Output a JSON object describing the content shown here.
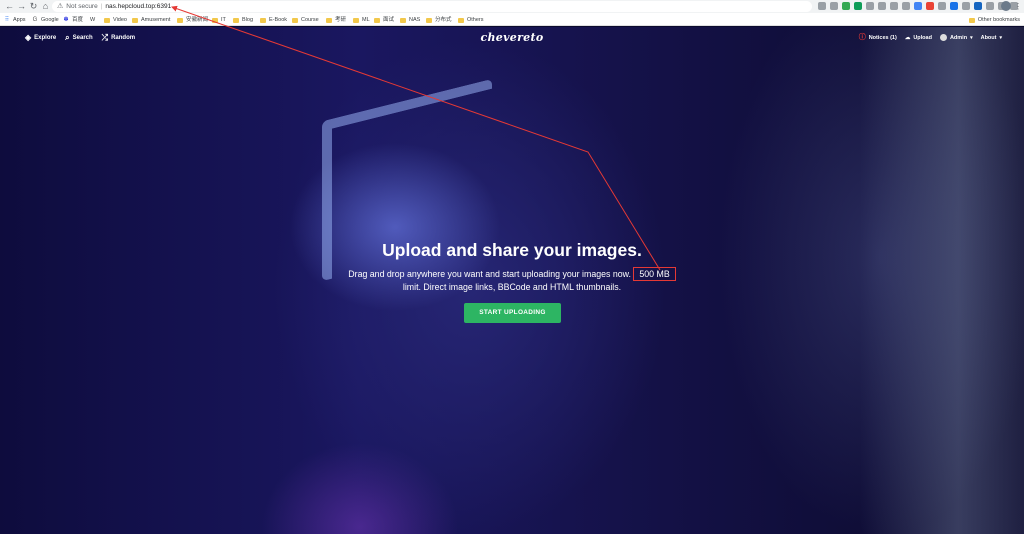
{
  "browser": {
    "security_label": "Not secure",
    "url": "nas.hepcloud.top:6391",
    "bookmarks": [
      {
        "label": "Apps",
        "kind": "apps"
      },
      {
        "label": "Google",
        "kind": "site"
      },
      {
        "label": "百度",
        "kind": "site"
      },
      {
        "label": "W",
        "kind": "site"
      },
      {
        "label": "Video",
        "kind": "folder"
      },
      {
        "label": "Amusement",
        "kind": "folder"
      },
      {
        "label": "安徽新闻",
        "kind": "folder"
      },
      {
        "label": "IT",
        "kind": "folder"
      },
      {
        "label": "Blog",
        "kind": "folder"
      },
      {
        "label": "E-Book",
        "kind": "folder"
      },
      {
        "label": "Course",
        "kind": "folder"
      },
      {
        "label": "考研",
        "kind": "folder"
      },
      {
        "label": "ML",
        "kind": "folder"
      },
      {
        "label": "面试",
        "kind": "folder"
      },
      {
        "label": "NAS",
        "kind": "folder"
      },
      {
        "label": "分布式",
        "kind": "folder"
      },
      {
        "label": "Others",
        "kind": "folder"
      }
    ],
    "other_bookmarks": "Other bookmarks"
  },
  "site": {
    "logo": "chevereto",
    "nav_left": [
      {
        "label": "Explore",
        "icon": "layers-icon",
        "glyph": "◈"
      },
      {
        "label": "Search",
        "icon": "search-icon",
        "glyph": "⌕"
      },
      {
        "label": "Random",
        "icon": "shuffle-icon",
        "glyph": "⤮"
      }
    ],
    "nav_right": {
      "notices": "Notices (1)",
      "upload": "Upload",
      "user": "Admin",
      "about": "About"
    }
  },
  "hero": {
    "title": "Upload and share your images.",
    "desc_before": "Drag and drop anywhere you want and start uploading your images now.",
    "limit": "500 MB",
    "desc_after": "limit. Direct image links, BBCode and HTML thumbnails.",
    "cta": "START UPLOADING"
  },
  "annotation": {
    "color": "#e53935"
  }
}
